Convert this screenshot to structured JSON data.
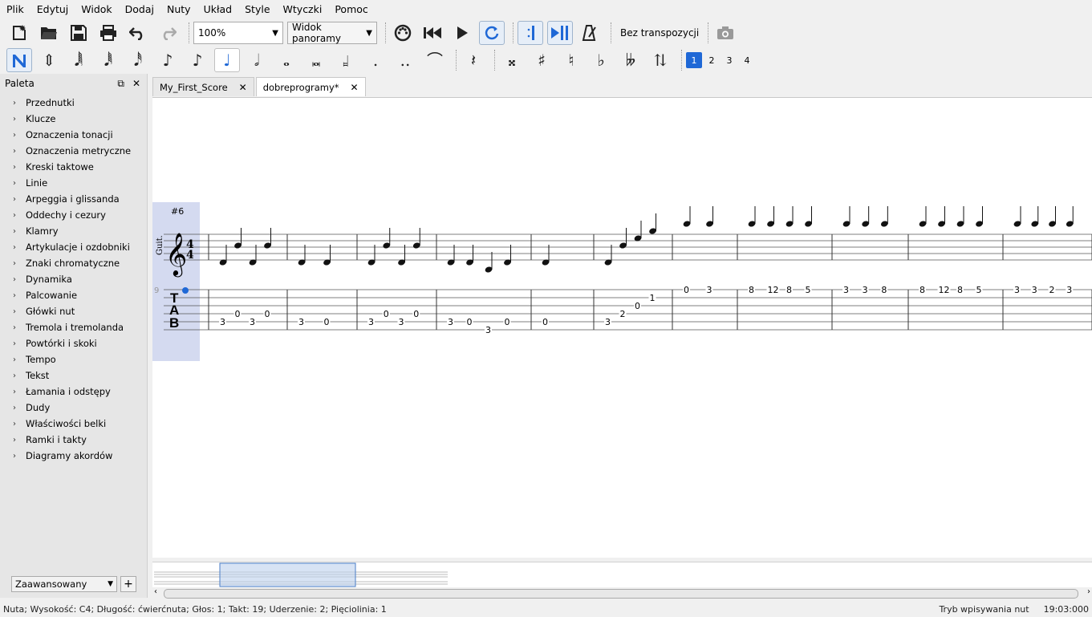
{
  "menu": [
    "Plik",
    "Edytuj",
    "Widok",
    "Dodaj",
    "Nuty",
    "Układ",
    "Style",
    "Wtyczki",
    "Pomoc"
  ],
  "toolbar": {
    "zoom_value": "100%",
    "view_mode": "Widok panoramy",
    "transpose_label": "Bez transpozycji"
  },
  "note_input": {
    "voices": [
      "1",
      "2",
      "3",
      "4"
    ],
    "selected_duration": "quarter-note",
    "active_voice": "1"
  },
  "palette": {
    "title": "Paleta",
    "items": [
      "Przednutki",
      "Klucze",
      "Oznaczenia tonacji",
      "Oznaczenia metryczne",
      "Kreski taktowe",
      "Linie",
      "Arpeggia i glissanda",
      "Oddechy i cezury",
      "Klamry",
      "Artykulacje i ozdobniki",
      "Znaki chromatyczne",
      "Dynamika",
      "Palcowanie",
      "Główki nut",
      "Tremola i tremolanda",
      "Powtórki i skoki",
      "Tempo",
      "Tekst",
      "Łamania i odstępy",
      "Dudy",
      "Właściwości belki",
      "Ramki i takty",
      "Diagramy akordów"
    ],
    "workspace": "Zaawansowany"
  },
  "tabs": [
    {
      "label": "My_First_Score"
    },
    {
      "label": "dobreprogramy*"
    }
  ],
  "score": {
    "string_label": "#6",
    "instrument_short": "Guit.",
    "measure_number": "9",
    "tab_letters": [
      "T",
      "A",
      "B"
    ],
    "tab_numbers": [
      {
        "text": "3",
        "s": 5,
        "m": 0
      },
      {
        "text": "0",
        "s": 4,
        "m": 0
      },
      {
        "text": "3",
        "s": 5,
        "m": 0
      },
      {
        "text": "0",
        "s": 4,
        "m": 0
      },
      {
        "text": "3",
        "s": 5,
        "m": 1
      },
      {
        "text": "0",
        "s": 5,
        "m": 1
      },
      {
        "text": "3",
        "s": 5,
        "m": 2
      },
      {
        "text": "0",
        "s": 4,
        "m": 2
      },
      {
        "text": "3",
        "s": 5,
        "m": 2
      },
      {
        "text": "0",
        "s": 4,
        "m": 2
      },
      {
        "text": "3",
        "s": 5,
        "m": 3
      },
      {
        "text": "0",
        "s": 5,
        "m": 3
      },
      {
        "text": "3",
        "s": 6,
        "m": 3
      },
      {
        "text": "0",
        "s": 5,
        "m": 3
      },
      {
        "text": "0",
        "s": 5,
        "m": 4
      },
      {
        "text": "3",
        "s": 5,
        "m": 5
      },
      {
        "text": "2",
        "s": 4,
        "m": 5
      },
      {
        "text": "0",
        "s": 3,
        "m": 5
      },
      {
        "text": "1",
        "s": 2,
        "m": 5
      },
      {
        "text": "0",
        "s": 1,
        "m": 6
      },
      {
        "text": "3",
        "s": 1,
        "m": 6
      },
      {
        "text": "8",
        "s": 1,
        "m": 7
      },
      {
        "text": "12",
        "s": 1,
        "m": 7
      },
      {
        "text": "8",
        "s": 1,
        "m": 7
      },
      {
        "text": "5",
        "s": 1,
        "m": 7
      },
      {
        "text": "3",
        "s": 1,
        "m": 8
      },
      {
        "text": "3",
        "s": 1,
        "m": 8
      },
      {
        "text": "8",
        "s": 1,
        "m": 8
      },
      {
        "text": "8",
        "s": 1,
        "m": 9
      },
      {
        "text": "12",
        "s": 1,
        "m": 9
      },
      {
        "text": "8",
        "s": 1,
        "m": 9
      },
      {
        "text": "5",
        "s": 1,
        "m": 9
      },
      {
        "text": "3",
        "s": 1,
        "m": 10
      },
      {
        "text": "3",
        "s": 1,
        "m": 10
      },
      {
        "text": "2",
        "s": 1,
        "m": 10
      },
      {
        "text": "3",
        "s": 1,
        "m": 10
      }
    ]
  },
  "status": {
    "left": "Nuta; Wysokość: C4; Długość: ćwierćnuta; Głos: 1;  Takt: 19; Uderzenie: 2; Pięciolinia: 1",
    "mode": "Tryb wpisywania nut",
    "time": "19:03:000"
  }
}
